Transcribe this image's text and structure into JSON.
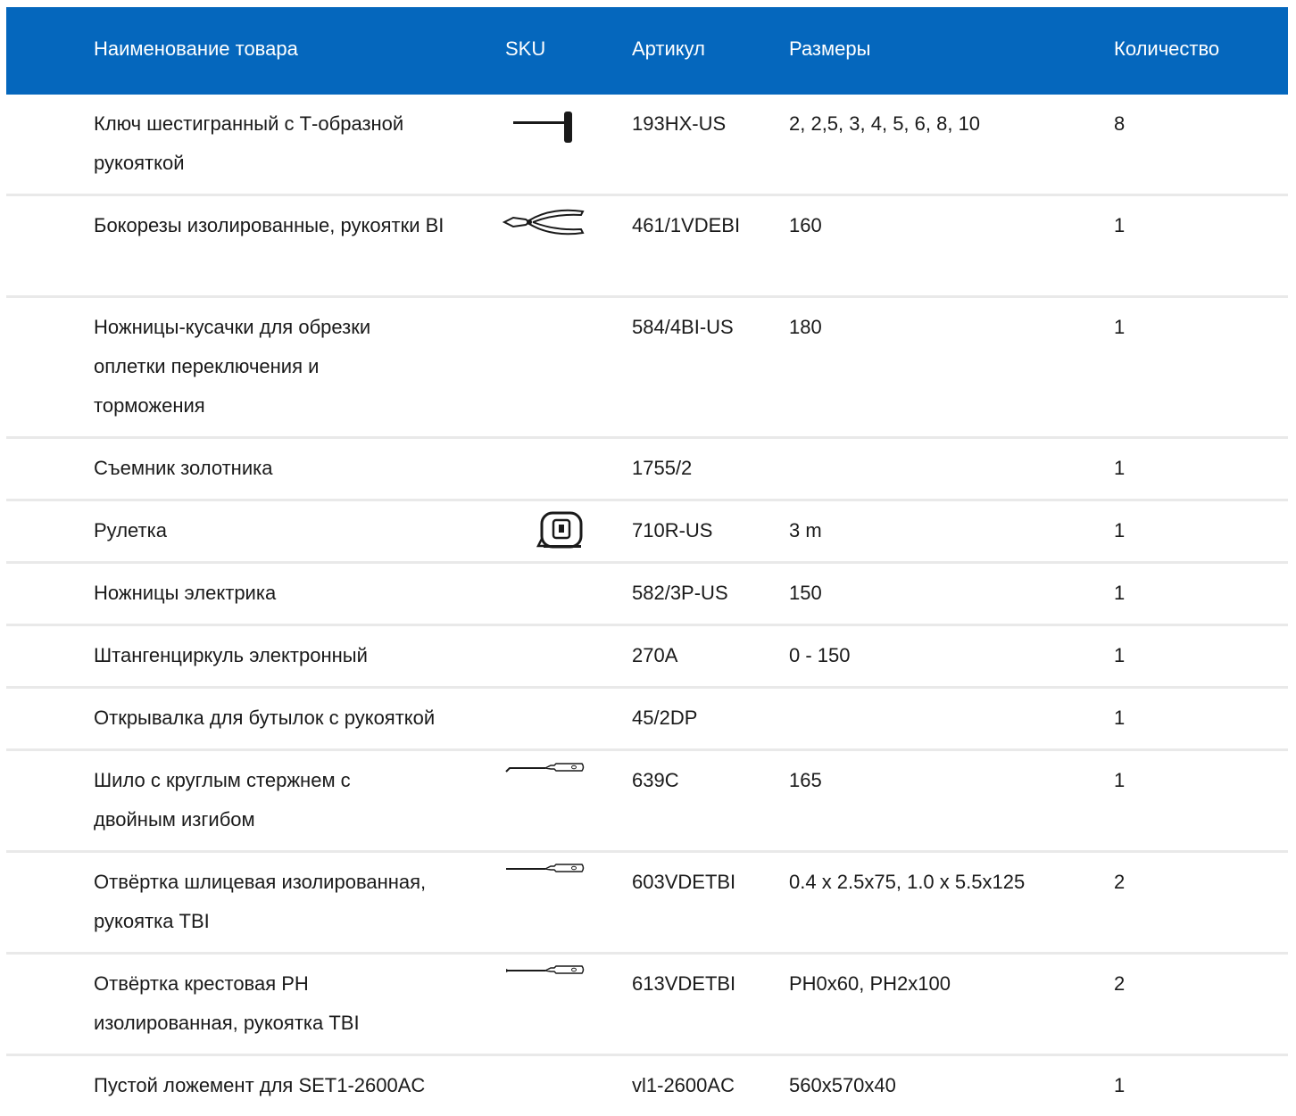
{
  "table": {
    "headers": {
      "name": "Наименование товара",
      "sku": "SKU",
      "article": "Артикул",
      "sizes": "Размеры",
      "qty": "Количество"
    },
    "rows": [
      {
        "name": "Ключ шестигранный с Т-образной рукояткой",
        "sku_icon": "t-handle-hex-key-icon",
        "article": "193HX-US",
        "sizes": "2, 2,5, 3, 4, 5, 6, 8, 10",
        "qty": "8"
      },
      {
        "name": "Бокорезы изолированные, рукоятки BI",
        "sku_icon": "side-cutters-icon",
        "article": "461/1VDEBI",
        "sizes": "160",
        "qty": "1"
      },
      {
        "name": "Ножницы-кусачки для обрезки оплетки переключения и торможения",
        "sku_icon": "",
        "article": "584/4BI-US",
        "sizes": "180",
        "qty": "1"
      },
      {
        "name": "Съемник золотника",
        "sku_icon": "",
        "article": "1755/2",
        "sizes": "",
        "qty": "1"
      },
      {
        "name": "Рулетка",
        "sku_icon": "tape-measure-icon",
        "article": "710R-US",
        "sizes": "3 m",
        "qty": "1"
      },
      {
        "name": "Ножницы электрика",
        "sku_icon": "",
        "article": "582/3P-US",
        "sizes": "150",
        "qty": "1"
      },
      {
        "name": "Штангенциркуль электронный",
        "sku_icon": "",
        "article": "270A",
        "sizes": "0 - 150",
        "qty": "1"
      },
      {
        "name": "Открывалка для бутылок с рукояткой",
        "sku_icon": "",
        "article": "45/2DP",
        "sizes": "",
        "qty": "1"
      },
      {
        "name": "Шило с круглым стержнем с двойным изгибом",
        "sku_icon": "awl-icon",
        "article": "639C",
        "sizes": "165",
        "qty": "1"
      },
      {
        "name": "Отвёртка шлицевая изолированная, рукоятка TBI",
        "sku_icon": "flat-screwdriver-icon",
        "article": "603VDETBI",
        "sizes": "0.4 x 2.5x75, 1.0 x 5.5x125",
        "qty": "2"
      },
      {
        "name": "Отвёртка крестовая PH изолированная, рукоятка TBI",
        "sku_icon": "phillips-screwdriver-icon",
        "article": "613VDETBI",
        "sizes": "PH0x60, PH2x100",
        "qty": "2"
      },
      {
        "name": "Пустой ложемент для SET1-2600AC",
        "sku_icon": "",
        "article": "vl1-2600AC",
        "sizes": "560x570x40",
        "qty": "1"
      }
    ]
  }
}
